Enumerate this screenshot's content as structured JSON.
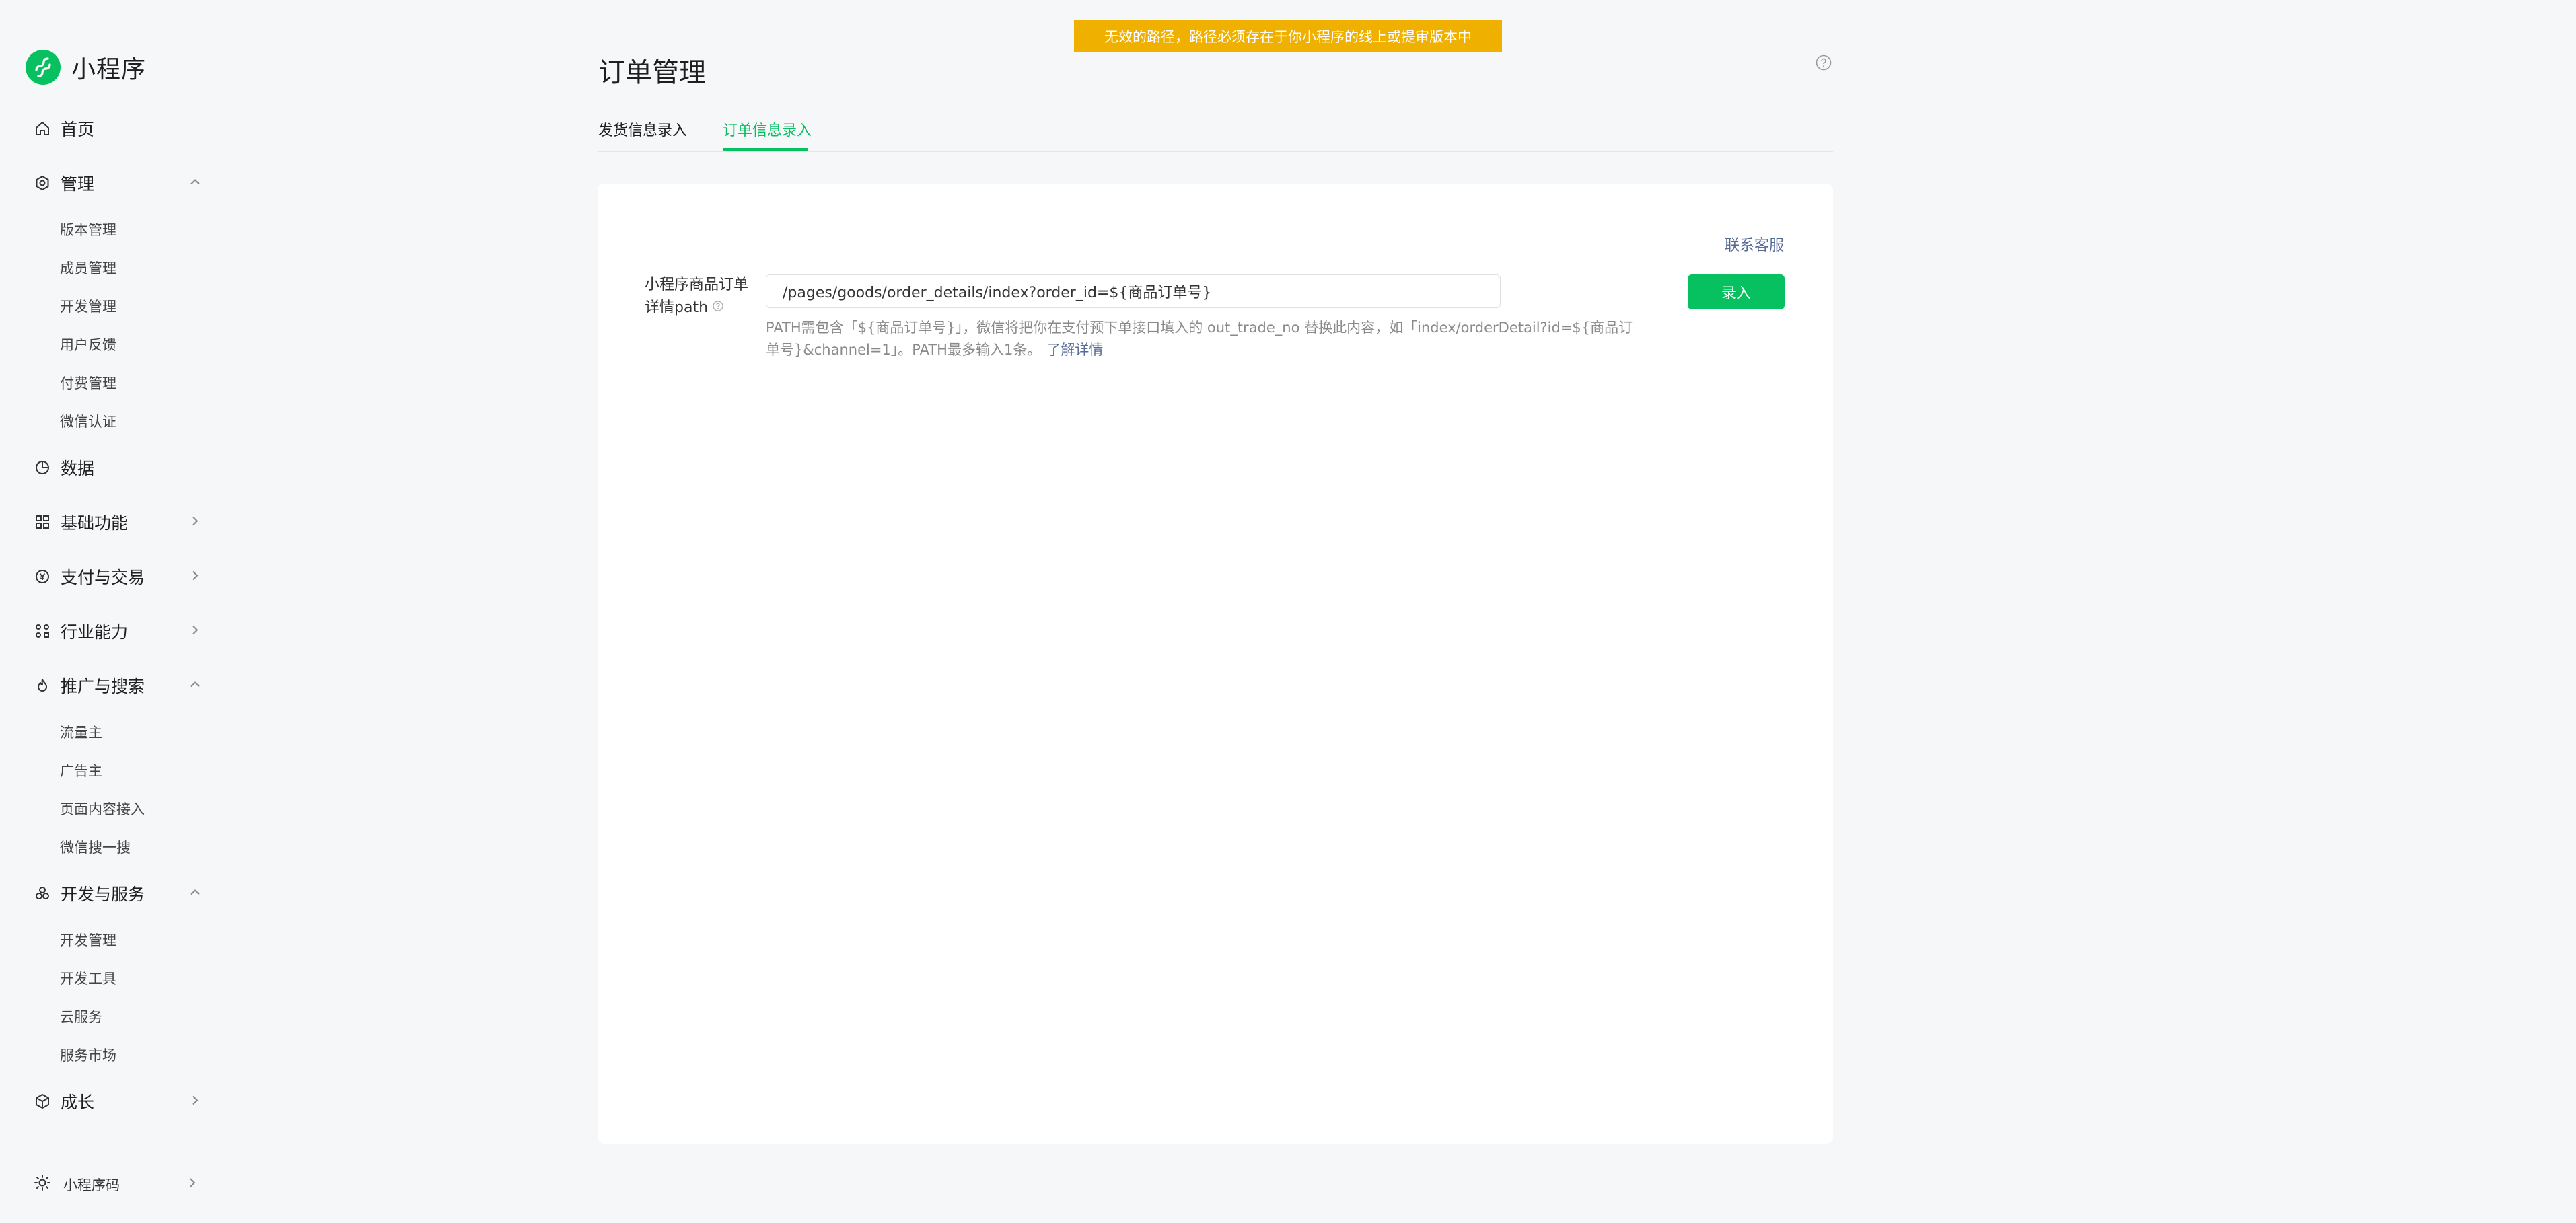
{
  "app": {
    "name": "小程序",
    "brand_color": "#07c160"
  },
  "banner": {
    "text": "无效的路径，路径必须存在于你小程序的线上或提审版本中",
    "color": "#f0b000"
  },
  "sidebar": {
    "home": {
      "label": "首页",
      "icon": "home-icon"
    },
    "manage": {
      "label": "管理",
      "icon": "settings-icon",
      "items": [
        "版本管理",
        "成员管理",
        "开发管理",
        "用户反馈",
        "付费管理",
        "微信认证"
      ]
    },
    "data": {
      "label": "数据",
      "icon": "pie-chart-icon"
    },
    "basic": {
      "label": "基础功能",
      "icon": "grid-icon"
    },
    "pay": {
      "label": "支付与交易",
      "icon": "yuan-icon"
    },
    "industry": {
      "label": "行业能力",
      "icon": "industry-icon"
    },
    "promo": {
      "label": "推广与搜索",
      "icon": "flame-icon",
      "items": [
        "流量主",
        "广告主",
        "页面内容接入",
        "微信搜一搜"
      ]
    },
    "dev": {
      "label": "开发与服务",
      "icon": "dev-service-icon",
      "items": [
        "开发管理",
        "开发工具",
        "云服务",
        "服务市场"
      ]
    },
    "growth": {
      "label": "成长",
      "icon": "growth-icon"
    },
    "qrcode": {
      "label": "小程序码",
      "icon": "sun-icon"
    }
  },
  "page": {
    "title": "订单管理",
    "tabs": [
      "发货信息录入",
      "订单信息录入"
    ],
    "active_tab": 1
  },
  "form": {
    "contact": "联系客服",
    "label": "小程序商品订单详情path",
    "input_value": "/pages/goods/order_details/index?order_id=${商品订单号}",
    "submit": "录入",
    "hint": "PATH需包含「${商品订单号}」，微信将把你在支付预下单接口填入的 out_trade_no 替换此内容，如「index/orderDetail?id=${商品订单号}&channel=1」。PATH最多输入1条。",
    "hint_link": "了解详情"
  }
}
